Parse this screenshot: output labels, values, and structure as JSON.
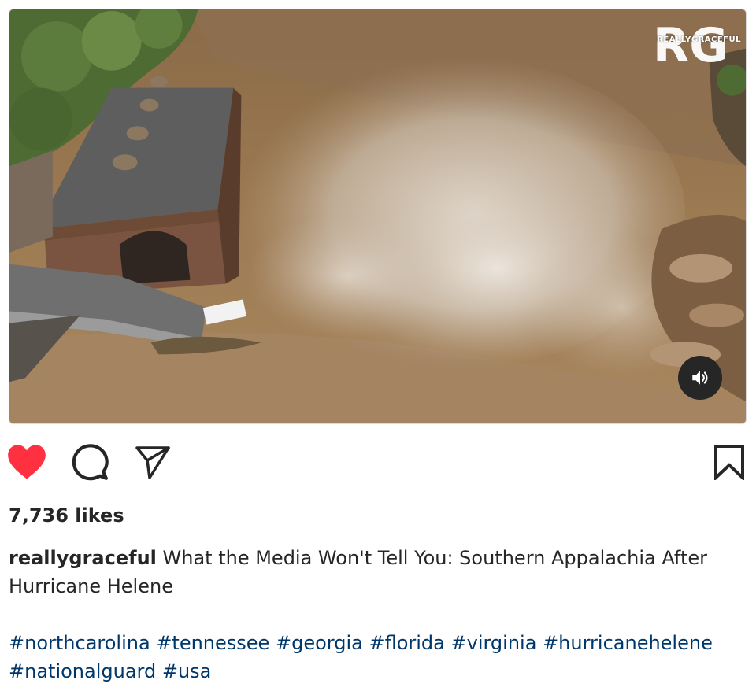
{
  "post": {
    "watermark": "REALLYGRACEFUL",
    "watermark_letters": "RG",
    "likes": "7,736 likes",
    "username": "reallygraceful",
    "caption": "What the Media Won't Tell You: Southern Appalachia After Hurricane Helene",
    "hashtags": [
      "#northcarolina",
      "#tennessee",
      "#georgia",
      "#florida",
      "#virginia",
      "#hurricanehelene",
      "#nationalguard",
      "#usa"
    ],
    "liked": true
  },
  "icons": {
    "like": "heart-icon",
    "comment": "comment-bubble-icon",
    "share": "paper-plane-icon",
    "save": "bookmark-icon",
    "audio": "speaker-icon"
  },
  "colors": {
    "heart": "#ff3040",
    "hashtag": "#00376b",
    "text": "#262626",
    "floodwater": "#9c7a52"
  }
}
